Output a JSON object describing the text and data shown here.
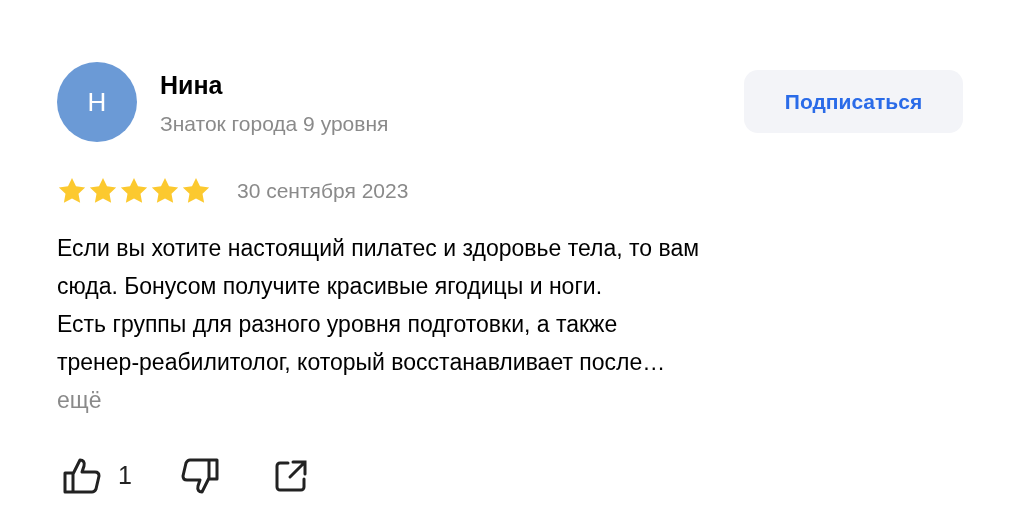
{
  "author": {
    "initial": "Н",
    "name": "Нина",
    "subtitle": "Знаток города 9 уровня"
  },
  "subscribe_button": "Подписаться",
  "rating": {
    "stars": 5,
    "date": "30 сентября 2023"
  },
  "review_text": "Если вы хотите настоящий пилатес и здоровье тела, то вам\nсюда. Бонусом получите красивые ягодицы и ноги.\nЕсть группы для разного уровня подготовки, а также\nтренер-реабилитолог, который восстанавливает после…",
  "more_link": "ещё",
  "likes": "1"
}
